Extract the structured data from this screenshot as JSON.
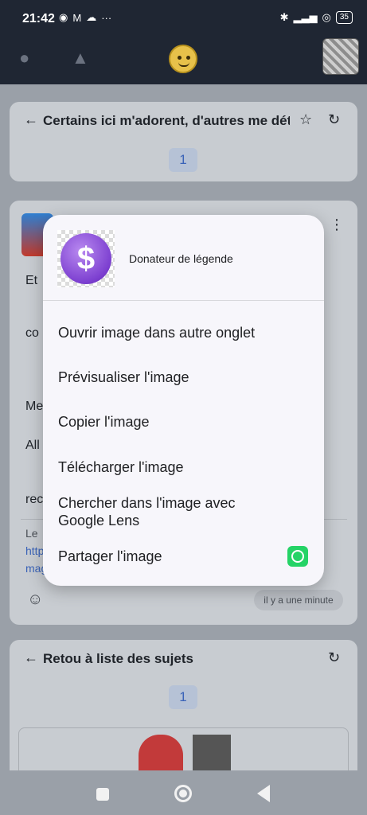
{
  "status": {
    "time": "21:42",
    "left_icons": [
      "facebook-icon",
      "gmail-icon",
      "cloud-icon",
      "more-dots"
    ],
    "battery": "35"
  },
  "header": {
    "icons": [
      "lightbulb-icon",
      "bell-icon",
      "emoji-face-icon",
      "profile-avatar"
    ]
  },
  "card1": {
    "title": "Certains ici m'adorent, d'autres me dét",
    "page": "1"
  },
  "post": {
    "fragments": [
      "Et ",
      "co",
      "Me",
      "All",
      "rec",
      "Le",
      "http",
      "mag"
    ],
    "timestamp": "il y a une minute"
  },
  "card3": {
    "title": "Retou à liste des sujets",
    "page": "1"
  },
  "context_menu": {
    "caption": "Donateur de légende",
    "items": [
      "Ouvrir image dans autre onglet",
      "Prévisualiser l'image",
      "Copier l'image",
      "Télécharger l'image",
      "Chercher dans l'image avec Google Lens",
      "Partager l'image"
    ],
    "share_icon": "whatsapp-icon",
    "image_symbol": "$"
  },
  "colors": {
    "status_bg": "#1f2633",
    "accent_chip": "#3a63b8",
    "whatsapp": "#25d366"
  }
}
